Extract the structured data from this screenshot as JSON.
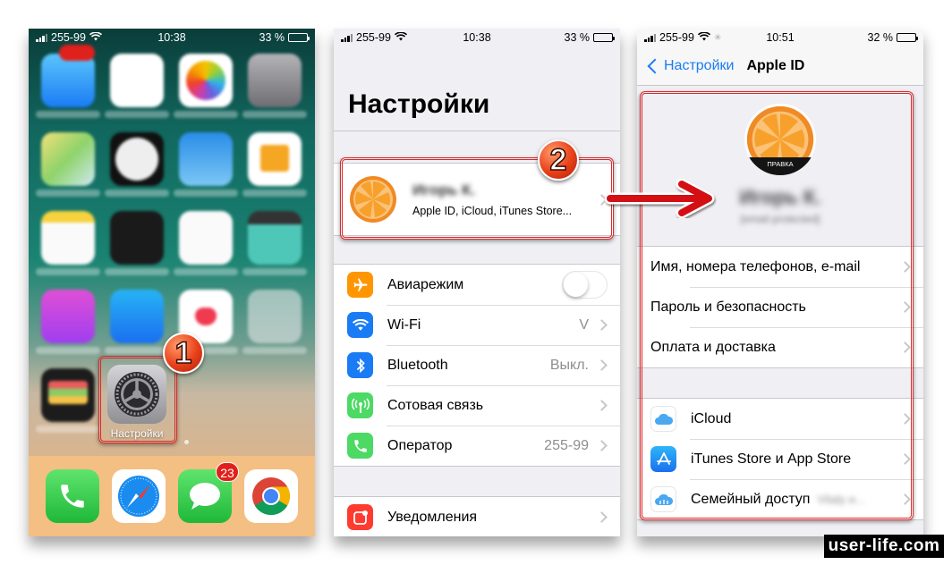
{
  "panels": {
    "home": {
      "status": {
        "carrier": "255-99",
        "time": "10:38",
        "battery": "33 %",
        "battery_level": 0.33
      },
      "highlighted_app": {
        "label": "Настройки",
        "icon": "gear-icon"
      },
      "step_marker": "1",
      "app_icons_blurred": [
        "mail",
        "calendar",
        "photos",
        "camera",
        "maps",
        "clock",
        "weather",
        "home",
        "notes",
        "stocks",
        "reminders",
        "videos",
        "itunes-store",
        "app-store",
        "health",
        "folder",
        "wallet"
      ],
      "dock": [
        {
          "name": "phone",
          "icon": "phone-icon"
        },
        {
          "name": "safari",
          "icon": "compass-icon"
        },
        {
          "name": "messages",
          "icon": "message-bubble-icon",
          "badge": "23"
        },
        {
          "name": "chrome",
          "icon": "chrome-icon"
        }
      ]
    },
    "settings": {
      "status": {
        "carrier": "255-99",
        "time": "10:38",
        "battery": "33 %",
        "battery_level": 0.33
      },
      "title": "Настройки",
      "step_marker": "2",
      "profile": {
        "name_blurred": "Игорь К.",
        "subtitle": "Apple ID, iCloud, iTunes Store..."
      },
      "group1": [
        {
          "label": "Авиарежим",
          "icon": "airplane-icon",
          "color": "#ff9500",
          "toggle": false
        },
        {
          "label": "Wi-Fi",
          "icon": "wifi-icon",
          "color": "#1a7cf5",
          "value": "V"
        },
        {
          "label": "Bluetooth",
          "icon": "bluetooth-icon",
          "color": "#1a7cf5",
          "value": "Выкл."
        },
        {
          "label": "Сотовая связь",
          "icon": "cellular-icon",
          "color": "#4cd964",
          "value": ""
        },
        {
          "label": "Оператор",
          "icon": "phone-icon",
          "color": "#4cd964",
          "value": "255-99"
        }
      ],
      "group2": [
        {
          "label": "Уведомления",
          "icon": "notifications-icon",
          "color": "#ff3b30"
        }
      ]
    },
    "appleid": {
      "status": {
        "carrier": "255-99",
        "time": "10:51",
        "battery": "32 %",
        "battery_level": 0.32
      },
      "back_label": "Настройки",
      "title": "Apple ID",
      "avatar_edit_label": "ПРАВКА",
      "name_blurred": "Игорь К.",
      "email_blurred": "[email protected]",
      "group1": [
        {
          "label": "Имя, номера телефонов, e-mail"
        },
        {
          "label": "Пароль и безопасность"
        },
        {
          "label": "Оплата и доставка"
        }
      ],
      "group2": [
        {
          "label": "iCloud",
          "icon": "icloud-icon"
        },
        {
          "label": "iTunes Store и App Store",
          "icon": "app-store-icon"
        },
        {
          "label": "Семейный доступ",
          "icon": "family-sharing-icon",
          "value_blurred": "Vitaly и..."
        }
      ]
    }
  },
  "annotation_colors": {
    "highlight": "#d92a2a",
    "step_marker": "#e8401a",
    "arrow": "#d40f14"
  },
  "watermark": "user-life.com"
}
